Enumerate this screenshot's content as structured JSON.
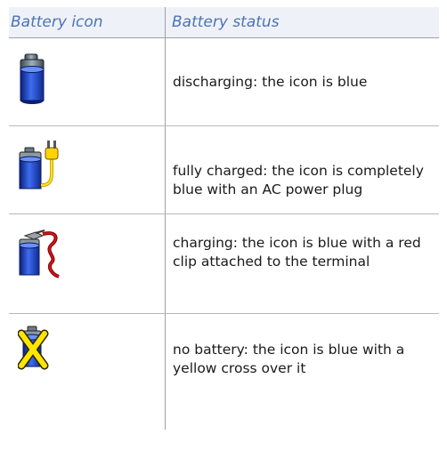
{
  "table": {
    "headers": {
      "icon": "Battery icon",
      "status": "Battery status"
    },
    "rows": [
      {
        "icon": "battery-discharging-icon",
        "status": "discharging: the icon is blue"
      },
      {
        "icon": "battery-charged-plug-icon",
        "status": "fully charged: the icon is completely blue with an AC power plug"
      },
      {
        "icon": "battery-charging-clip-icon",
        "status": "charging: the icon is blue with a red clip attached to the terminal"
      },
      {
        "icon": "battery-none-cross-icon",
        "status": "no battery: the icon is blue with a yellow cross over it"
      }
    ]
  }
}
